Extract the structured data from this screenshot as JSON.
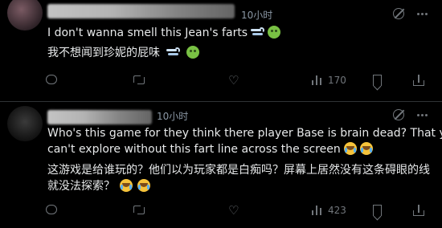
{
  "posts": [
    {
      "time": "10小时",
      "line1": "I don't wanna smell this Jean's farts",
      "line2": "我不想闻到珍妮的屁味",
      "actions": {
        "replies": "",
        "retweets": "",
        "likes": "",
        "views": "170"
      },
      "icons": [
        "grok-icon",
        "more-icon",
        "reply-icon",
        "retweet-icon",
        "like-icon",
        "views-icon",
        "bookmark-icon",
        "share-icon"
      ]
    },
    {
      "time": "10小时",
      "line1": "Who's this game for they think there player Base is brain dead? That you",
      "line2": "can't explore without this fart line across the screen",
      "line3": "这游戏是给谁玩的？他们以为玩家都是白痴吗？屏幕上居然没有这条碍眼的线",
      "line4": "就没法探索？",
      "actions": {
        "replies": "",
        "retweets": "",
        "likes": "",
        "views": "423"
      },
      "icons": [
        "grok-icon",
        "more-icon",
        "reply-icon",
        "retweet-icon",
        "like-icon",
        "views-icon",
        "bookmark-icon",
        "share-icon"
      ]
    }
  ],
  "colors": {
    "background": "#000000",
    "text": "#e7e9ea",
    "muted": "#71767b",
    "divider": "#2f3336"
  }
}
